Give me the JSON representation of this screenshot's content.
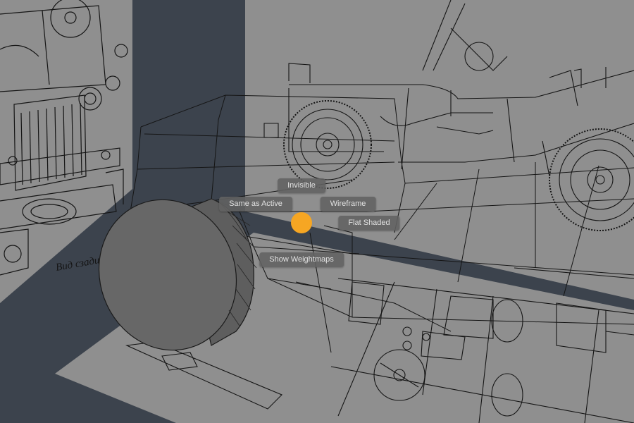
{
  "viewport": {
    "background_color": "#3c434d",
    "wall_color": "#8f8f8f",
    "line_color": "#151515",
    "wheel_color": "#676767"
  },
  "front_view": {
    "caption": "Вид сзади"
  },
  "pie_menu": {
    "accent_color": "#f6a623",
    "items": {
      "invisible": "Invisible",
      "same_as_active": "Same as Active",
      "wireframe": "Wireframe",
      "flat_shaded": "Flat Shaded",
      "show_weightmaps": "Show Weightmaps"
    }
  }
}
